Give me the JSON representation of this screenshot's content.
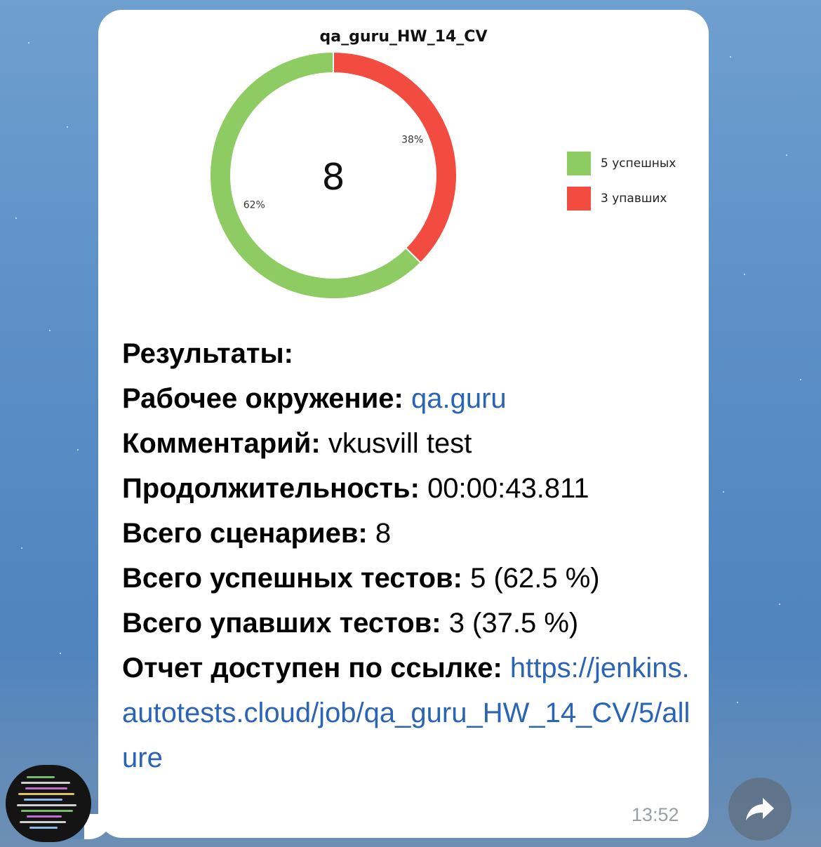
{
  "message": {
    "time": "13:52",
    "results_heading": "Результаты:",
    "environment": {
      "label": "Рабочее окружение:",
      "value": "qa.guru"
    },
    "comment": {
      "label": "Комментарий:",
      "value": "vkusvill test"
    },
    "duration": {
      "label": "Продолжительность:",
      "value": "00:00:43.811"
    },
    "total_scenarios": {
      "label": "Всего сценариев:",
      "value": "8"
    },
    "passed_tests": {
      "label": "Всего успешных тестов:",
      "value": "5 (62.5 %)"
    },
    "failed_tests": {
      "label": "Всего упавших тестов:",
      "value": "3 (37.5 %)"
    },
    "report": {
      "label": "Отчет доступен по ссылке:",
      "url": "https://jenkins.autotests.cloud/job/qa_guru_HW_14_CV/5/allure"
    }
  },
  "chart_data": {
    "type": "pie",
    "title": "qa_guru_HW_14_CV",
    "center_label": "8",
    "categories": [
      "5 успешных",
      "3 упавших"
    ],
    "values": [
      5,
      3
    ],
    "percent_labels": [
      "62%",
      "38%"
    ],
    "colors": [
      "#8ecb63",
      "#f24b3f"
    ],
    "legend": "right"
  },
  "icons": {
    "share": "share-arrow-icon",
    "avatar": "avatar"
  }
}
